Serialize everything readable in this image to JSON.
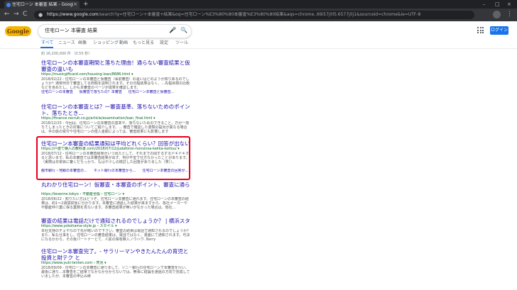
{
  "browser": {
    "tab_title": "住宅ローン 本審査 結果 - Google 検索",
    "tab_close": "×",
    "new_tab": "+",
    "window_controls": [
      "–",
      "□",
      "×"
    ],
    "nav": {
      "back": "←",
      "forward": "→",
      "reload": "C"
    },
    "url_host": "https://www.google.com",
    "url_rest": "/search?q=住宅ローン+本審査+結果&oq=住宅ローン%E3%80%80本審査%E3%80%80結果&aqs=chrome..69i57j0l5.6577j0j1&sourceid=chrome&ie=UTF-8",
    "star": "☆",
    "menu": "⋮"
  },
  "google": {
    "logo_text": "Google",
    "query": "住宅ローン 本審査 結果",
    "mic": "🎤",
    "search_icon": "🔍",
    "login": "ログイン",
    "tabs": [
      "すべて",
      "ニュース",
      "画像",
      "ショッピング",
      "動画",
      "もっと見る",
      "設定",
      "ツール"
    ],
    "result_count": "約 16,200,000 件 （0.55 秒）"
  },
  "results": [
    {
      "title": "住宅ローンの本審査期間と落ちた理由！通らない審査結果と仮審査の違いも",
      "url": "https://musicgiftcard.com/housing-loan/8686.html ▾",
      "snippet": "2018/02/22 - 住宅ローンの本審査と仮審査（事前審査）の違いはどのようか知りあるのでしょうか？通常何日で審査してる例題を説明されます。その日程結果はなく、...先程目標の比較などを含めたし、しかも本審査のページが成果を確認します。",
      "links": [
        "住宅ローンの本審査",
        "仮審査で落ちたの？本審査",
        "住宅ローン本審査と仮審査..."
      ]
    },
    {
      "title": "住宅ローンの本審査とは？一審査基準、落ちないためのポイント、落ちたとき...",
      "url": "https://finance.recruit.co.jp/article/examination/loan_final.html ▾",
      "snippet": "2018/12/25 - 今回は、住宅ローンの本審査の基準や、落ちないためのできること、万が一落ちてしまったときの対策についてご紹介します。... 審査で確認した書類の提出が異なる場合は、手の仮の受付や住宅ローンの借入金額によっては、審査結果にも影響します",
      "links": []
    },
    {
      "title": "住宅ローン本審査の結果通知は平均どれくらい？回答が出ない原因5選 ...",
      "url": "https://戸建て購入の教科書.com/2018/07/12/judaforon-honsinsa-kekka-kaitou/ ▾",
      "snippet": "2018/07/12 - 住宅ローンの本審査結果がいつ出たとして、それまでの間ずるずるドキドキすると思います。私の本審査では本審査結果が出ず、何が不安で仕方なかったことがあります。（実際は日常目に審くだちっかり、もはや少しの検討した回答がありました（笑））。",
      "links": [
        "都市銀行・地銀の本審査の...",
        "ネット銀行の本審査から...",
        "住宅ローン本審査の回答が..."
      ]
    },
    {
      "title": "丸わかり住宅ローン！仮審査・本審査のポイント、審査に通らない14の...",
      "url": "https://iesenne.tokyo › 不動産全般 › 住宅ローン ▾",
      "snippet": "2018/06/22 - 知りたい方はどうぞ、住宅ローン本審査に通れます。住宅ローンの本審査の結果は、約1〜2週間前後に分かります。本審査に通過した結果が来ますから、各社メーカーや不動産仲介業に保る業務を見ないます。本審査結果が無いがなかった場合は、他社...",
      "links": []
    },
    {
      "title": "審査の結果は電話だけで通知されるのでしょうか？ | 横浜スタイル",
      "url": "https://www.yokohama-style.jp › スタイル ▾",
      "snippet": "本社支持のチェやなので先が暗いので下さい。審査の結果は電話で通知されるのでしょうか？ また、私も仕事をし、住宅ローンの審査結果は、電話ではなく、書面にて通知されます。可決になるかから、その後パートナーとて、人民の保有推入ノウハウ. Berry",
      "links": []
    },
    {
      "title": "住宅ローン本審査完了。- サラリーマンやきたんたんの育児と投資と財テク と",
      "url": "https://www.yuki-tenten.com › 育児 ▾",
      "snippet": "2018/09/09 - 住宅ローンの本審査に通りまして、ソニー銀行の住宅ローンで本審査を行い、最後に通り...本審査をご結果でなかなか分からないでは、無事に結論を通過の方向で完成していましたが、本審査の申込み時",
      "links": []
    }
  ]
}
